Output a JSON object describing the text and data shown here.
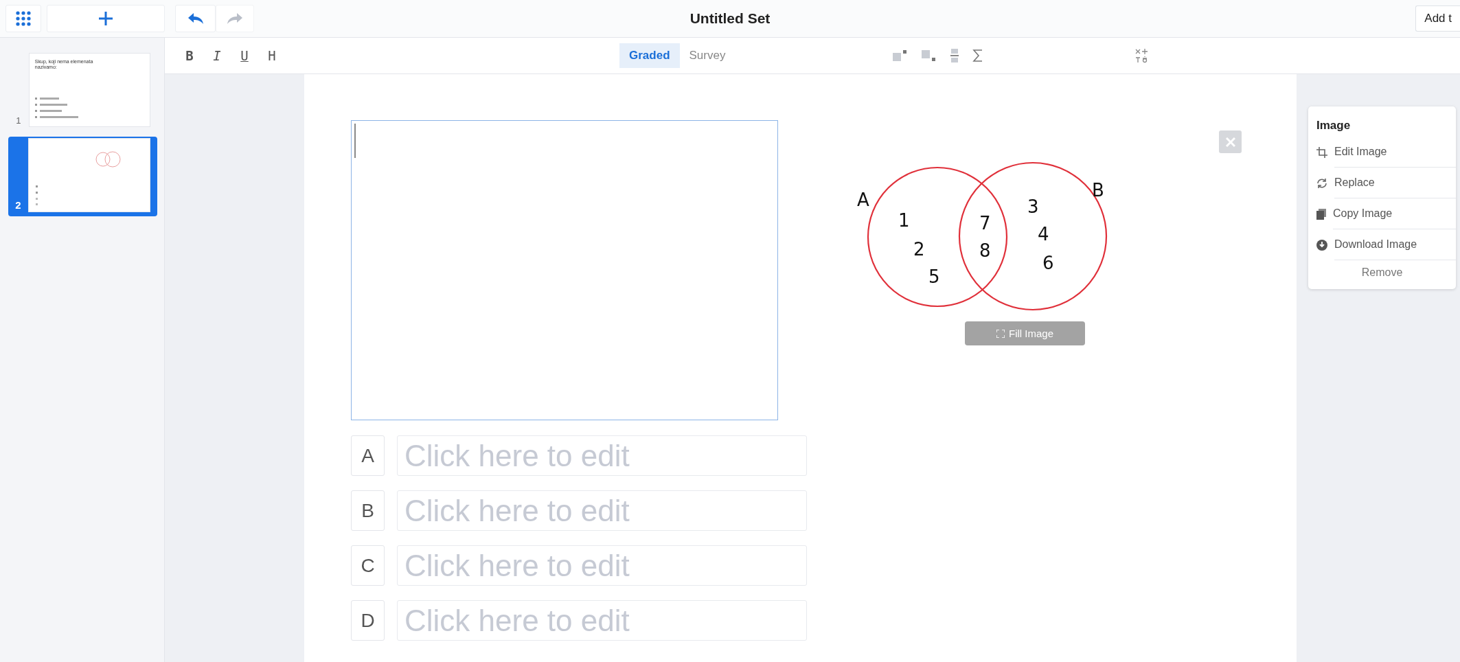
{
  "top_bar": {
    "title": "Untitled Set",
    "action_button": "Add t"
  },
  "slides": [
    {
      "number": "1",
      "selected": false,
      "kind": "text",
      "question": "Skup, koji nema elemenata nazivamo:"
    },
    {
      "number": "2",
      "selected": true,
      "kind": "image"
    }
  ],
  "format_buttons": [
    {
      "label": "B",
      "kind": "bold"
    },
    {
      "label": "I",
      "kind": "italic"
    },
    {
      "label": "U",
      "kind": "underline"
    },
    {
      "label": "H",
      "kind": "heading"
    }
  ],
  "modes": [
    {
      "label": "Graded",
      "selected": true
    },
    {
      "label": "Survey",
      "selected": false
    }
  ],
  "editor": {
    "answers": [
      {
        "letter": "A",
        "placeholder": "Click here to edit"
      },
      {
        "letter": "B",
        "placeholder": "Click here to edit"
      },
      {
        "letter": "C",
        "placeholder": "Click here to edit"
      },
      {
        "letter": "D",
        "placeholder": "Click here to edit"
      }
    ],
    "venn": {
      "set_labels": [
        "A",
        "B"
      ],
      "only_a": [
        "1",
        "2",
        "5"
      ],
      "both": [
        "7",
        "8"
      ],
      "only_b": [
        "3",
        "4",
        "6"
      ]
    },
    "fill_button": "Fill Image"
  },
  "image_menu": {
    "title": "Image",
    "items": [
      {
        "label": "Edit Image",
        "kind": "crop"
      },
      {
        "label": "Replace",
        "kind": "refresh"
      },
      {
        "label": "Copy Image",
        "kind": "copy"
      },
      {
        "label": "Download Image",
        "kind": "download"
      }
    ],
    "remove": "Remove"
  }
}
